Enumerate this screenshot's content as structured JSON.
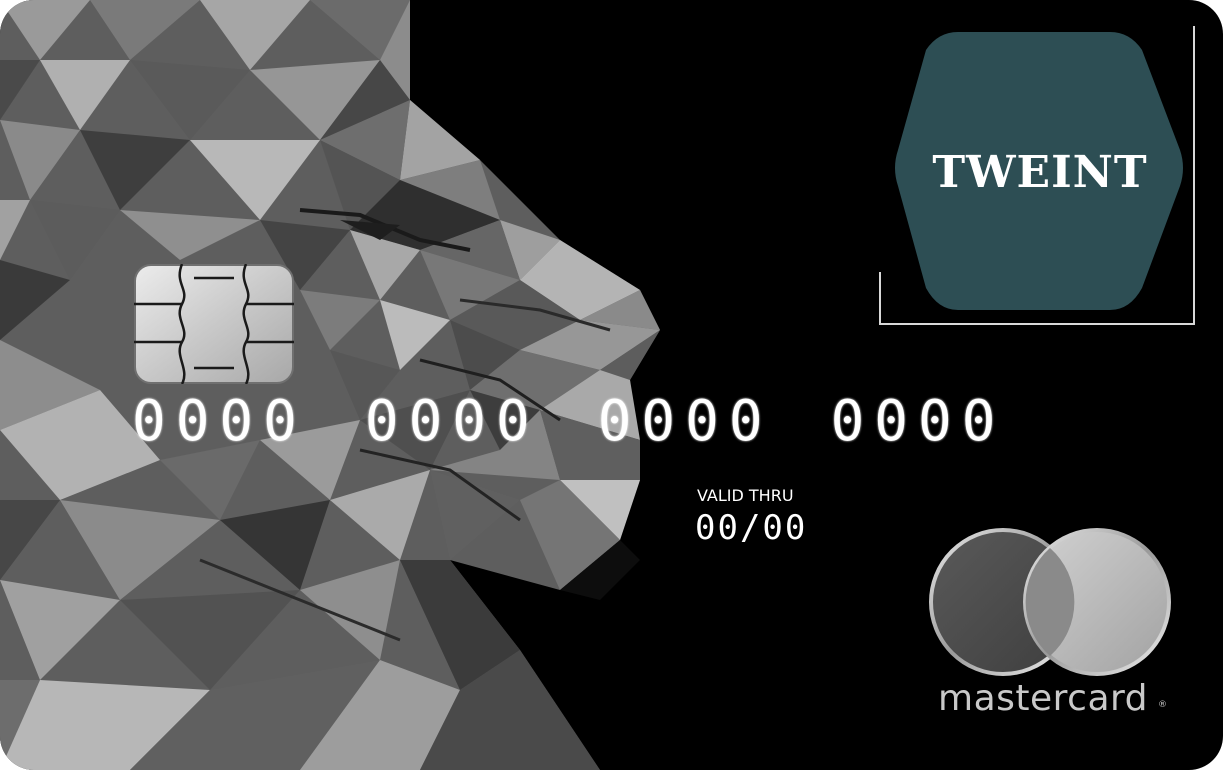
{
  "card": {
    "issuer_name": "TWEINT",
    "number_groups": [
      "0000",
      "0000",
      "0000",
      "0000"
    ],
    "valid_thru_label": "VALID THRU",
    "valid_thru_value": "00/00",
    "network_name": "mastercard",
    "network_mark": "®"
  },
  "icons": {
    "background_art": "low-poly-lion-icon",
    "chip": "emv-chip-icon",
    "network_logo": "mastercard-circles-icon"
  },
  "colors": {
    "card_background": "#000000",
    "issuer_badge": "#2d4e54",
    "text": "#ffffff",
    "network_text": "#c9c9c9"
  }
}
